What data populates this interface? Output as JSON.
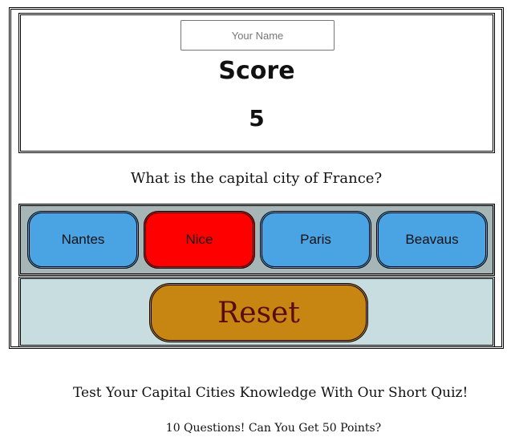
{
  "name_input": {
    "placeholder": "Your Name",
    "value": ""
  },
  "score": {
    "label": "Score",
    "value": "5"
  },
  "question": "What is the capital city of France?",
  "answers": [
    {
      "label": "Nantes",
      "state": "default"
    },
    {
      "label": "Nice",
      "state": "wrong"
    },
    {
      "label": "Paris",
      "state": "default"
    },
    {
      "label": "Beavaus",
      "state": "default"
    }
  ],
  "reset_label": "Reset",
  "tagline": "Test Your Capital Cities Knowledge With Our Short Quiz!",
  "subline": "10 Questions! Can You Get 50 Points?",
  "colors": {
    "answer_default": "#4aa3e2",
    "answer_wrong": "#ff0000",
    "answers_panel": "#a6b5b6",
    "reset_panel": "#c8dde0",
    "reset_button": "#c78511",
    "reset_text": "#5a0d08"
  }
}
